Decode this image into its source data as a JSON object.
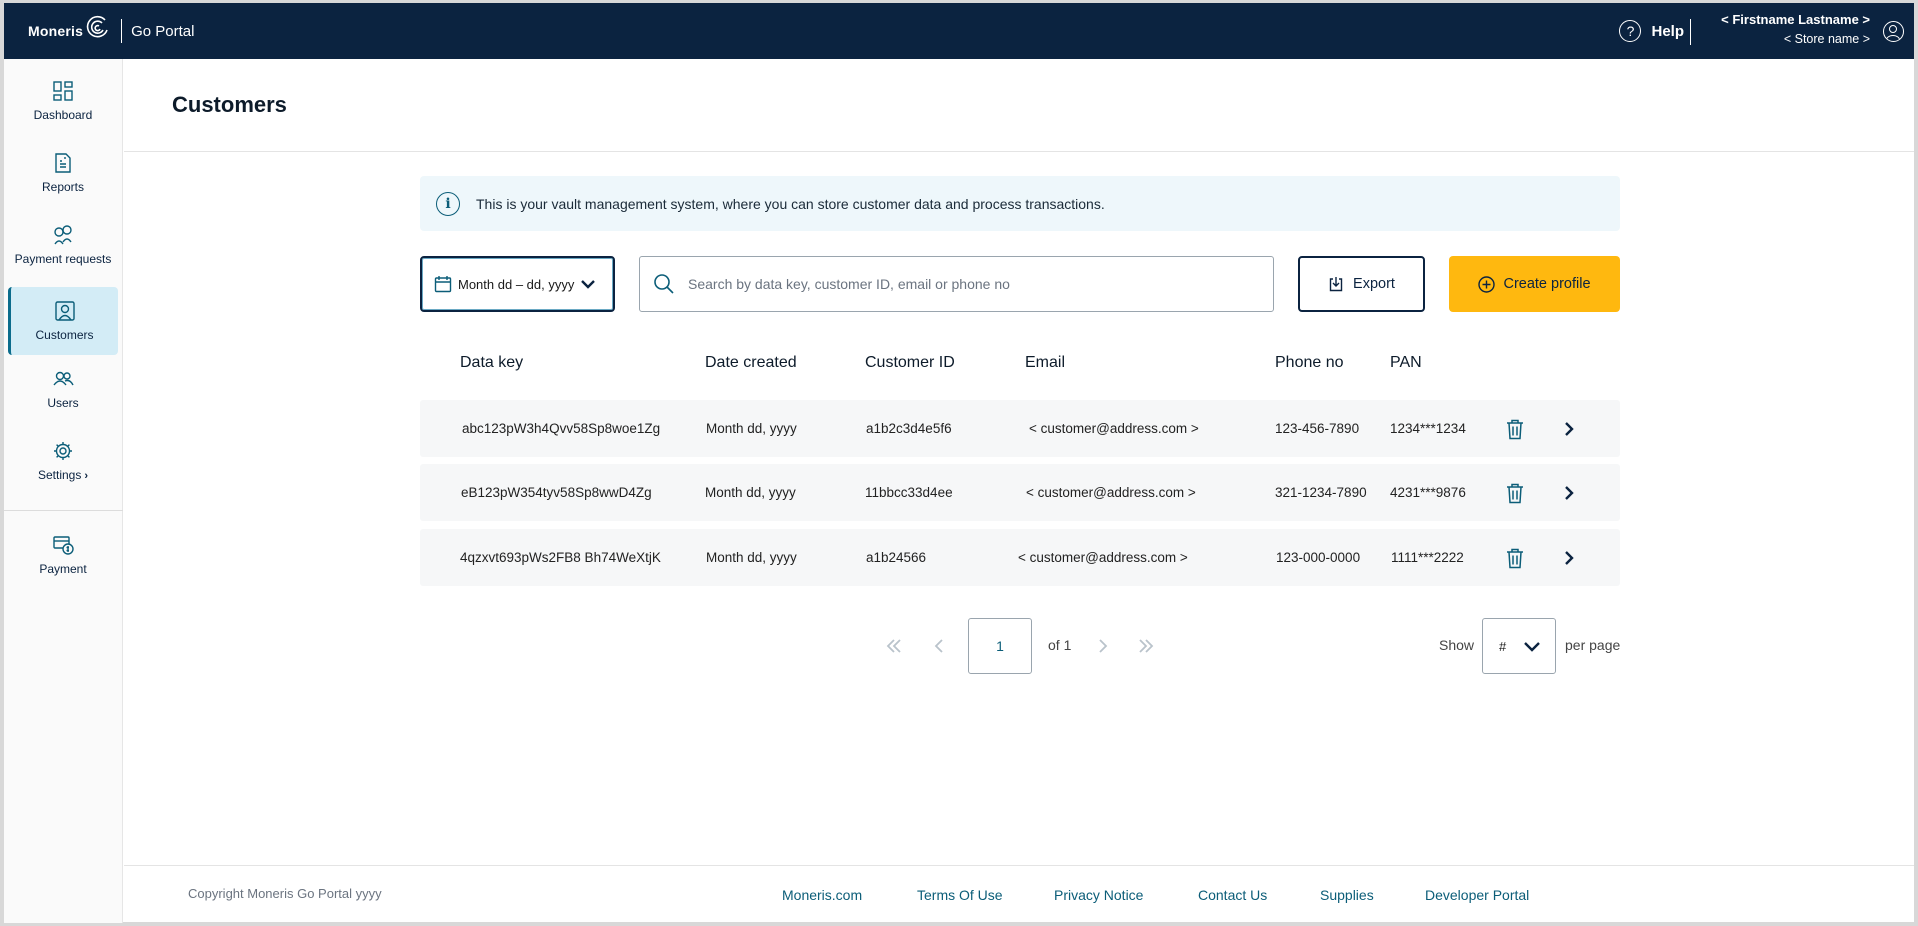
{
  "app": {
    "brand": "Moneris",
    "portal_name": "Go Portal"
  },
  "header": {
    "help_label": "Help",
    "user_name": "< Firstname Lastname >",
    "store_name": "< Store name >"
  },
  "sidebar": {
    "items": [
      {
        "label": "Dashboard",
        "icon": "dashboard-icon"
      },
      {
        "label": "Reports",
        "icon": "reports-icon"
      },
      {
        "label": "Payment requests",
        "icon": "payment-requests-icon"
      },
      {
        "label": "Customers",
        "icon": "customers-icon",
        "active": true
      },
      {
        "label": "Users",
        "icon": "users-icon"
      },
      {
        "label": "Settings",
        "icon": "gear-icon",
        "suffix": "›"
      },
      {
        "label": "Payment",
        "icon": "payment-icon"
      }
    ]
  },
  "page": {
    "title": "Customers",
    "info_text": "This is your vault management system, where you can store customer data and process transactions."
  },
  "toolbar": {
    "date_range": "Month dd – dd, yyyy",
    "search_placeholder": "Search by data key, customer ID, email or phone no",
    "export_label": "Export",
    "create_label": "Create profile"
  },
  "table": {
    "headers": [
      "Data key",
      "Date created",
      "Customer ID",
      "Email",
      "Phone no",
      "PAN"
    ],
    "rows": [
      {
        "data_key": "abc123pW3h4Qvv58Sp8woe1Zg",
        "date_created": "Month dd, yyyy",
        "customer_id": "a1b2c3d4e5f6",
        "email": "< customer@address.com >",
        "phone": "123-456-7890",
        "pan": "1234***1234"
      },
      {
        "data_key": "eB123pW354tyv58Sp8wwD4Zg",
        "date_created": "Month dd, yyyy",
        "customer_id": "11bbcc33d4ee",
        "email": "< customer@address.com >",
        "phone": "321-1234-7890",
        "pan": "4231***9876"
      },
      {
        "data_key": "4qzxvt693pWs2FB8 Bh74WeXtjK",
        "date_created": "Month dd, yyyy",
        "customer_id": "a1b24566",
        "email": "< customer@address.com >",
        "phone": "123-000-0000",
        "pan": "1111***2222"
      }
    ]
  },
  "pagination": {
    "current_page": "1",
    "of_text": "of 1",
    "show_label": "Show",
    "per_page_value": "#",
    "per_page_label": "per page"
  },
  "footer": {
    "copyright": "Copyright Moneris Go Portal  yyyy",
    "links": [
      "Moneris.com",
      "Terms Of Use",
      "Privacy Notice",
      "Contact Us",
      "Supplies",
      "Developer Portal"
    ]
  },
  "colors": {
    "header_bg": "#0b2340",
    "accent": "#0b5d78",
    "create_button": "#ffb80f",
    "active_nav": "#d3ecf6",
    "row_bg": "#f6f7f8"
  }
}
